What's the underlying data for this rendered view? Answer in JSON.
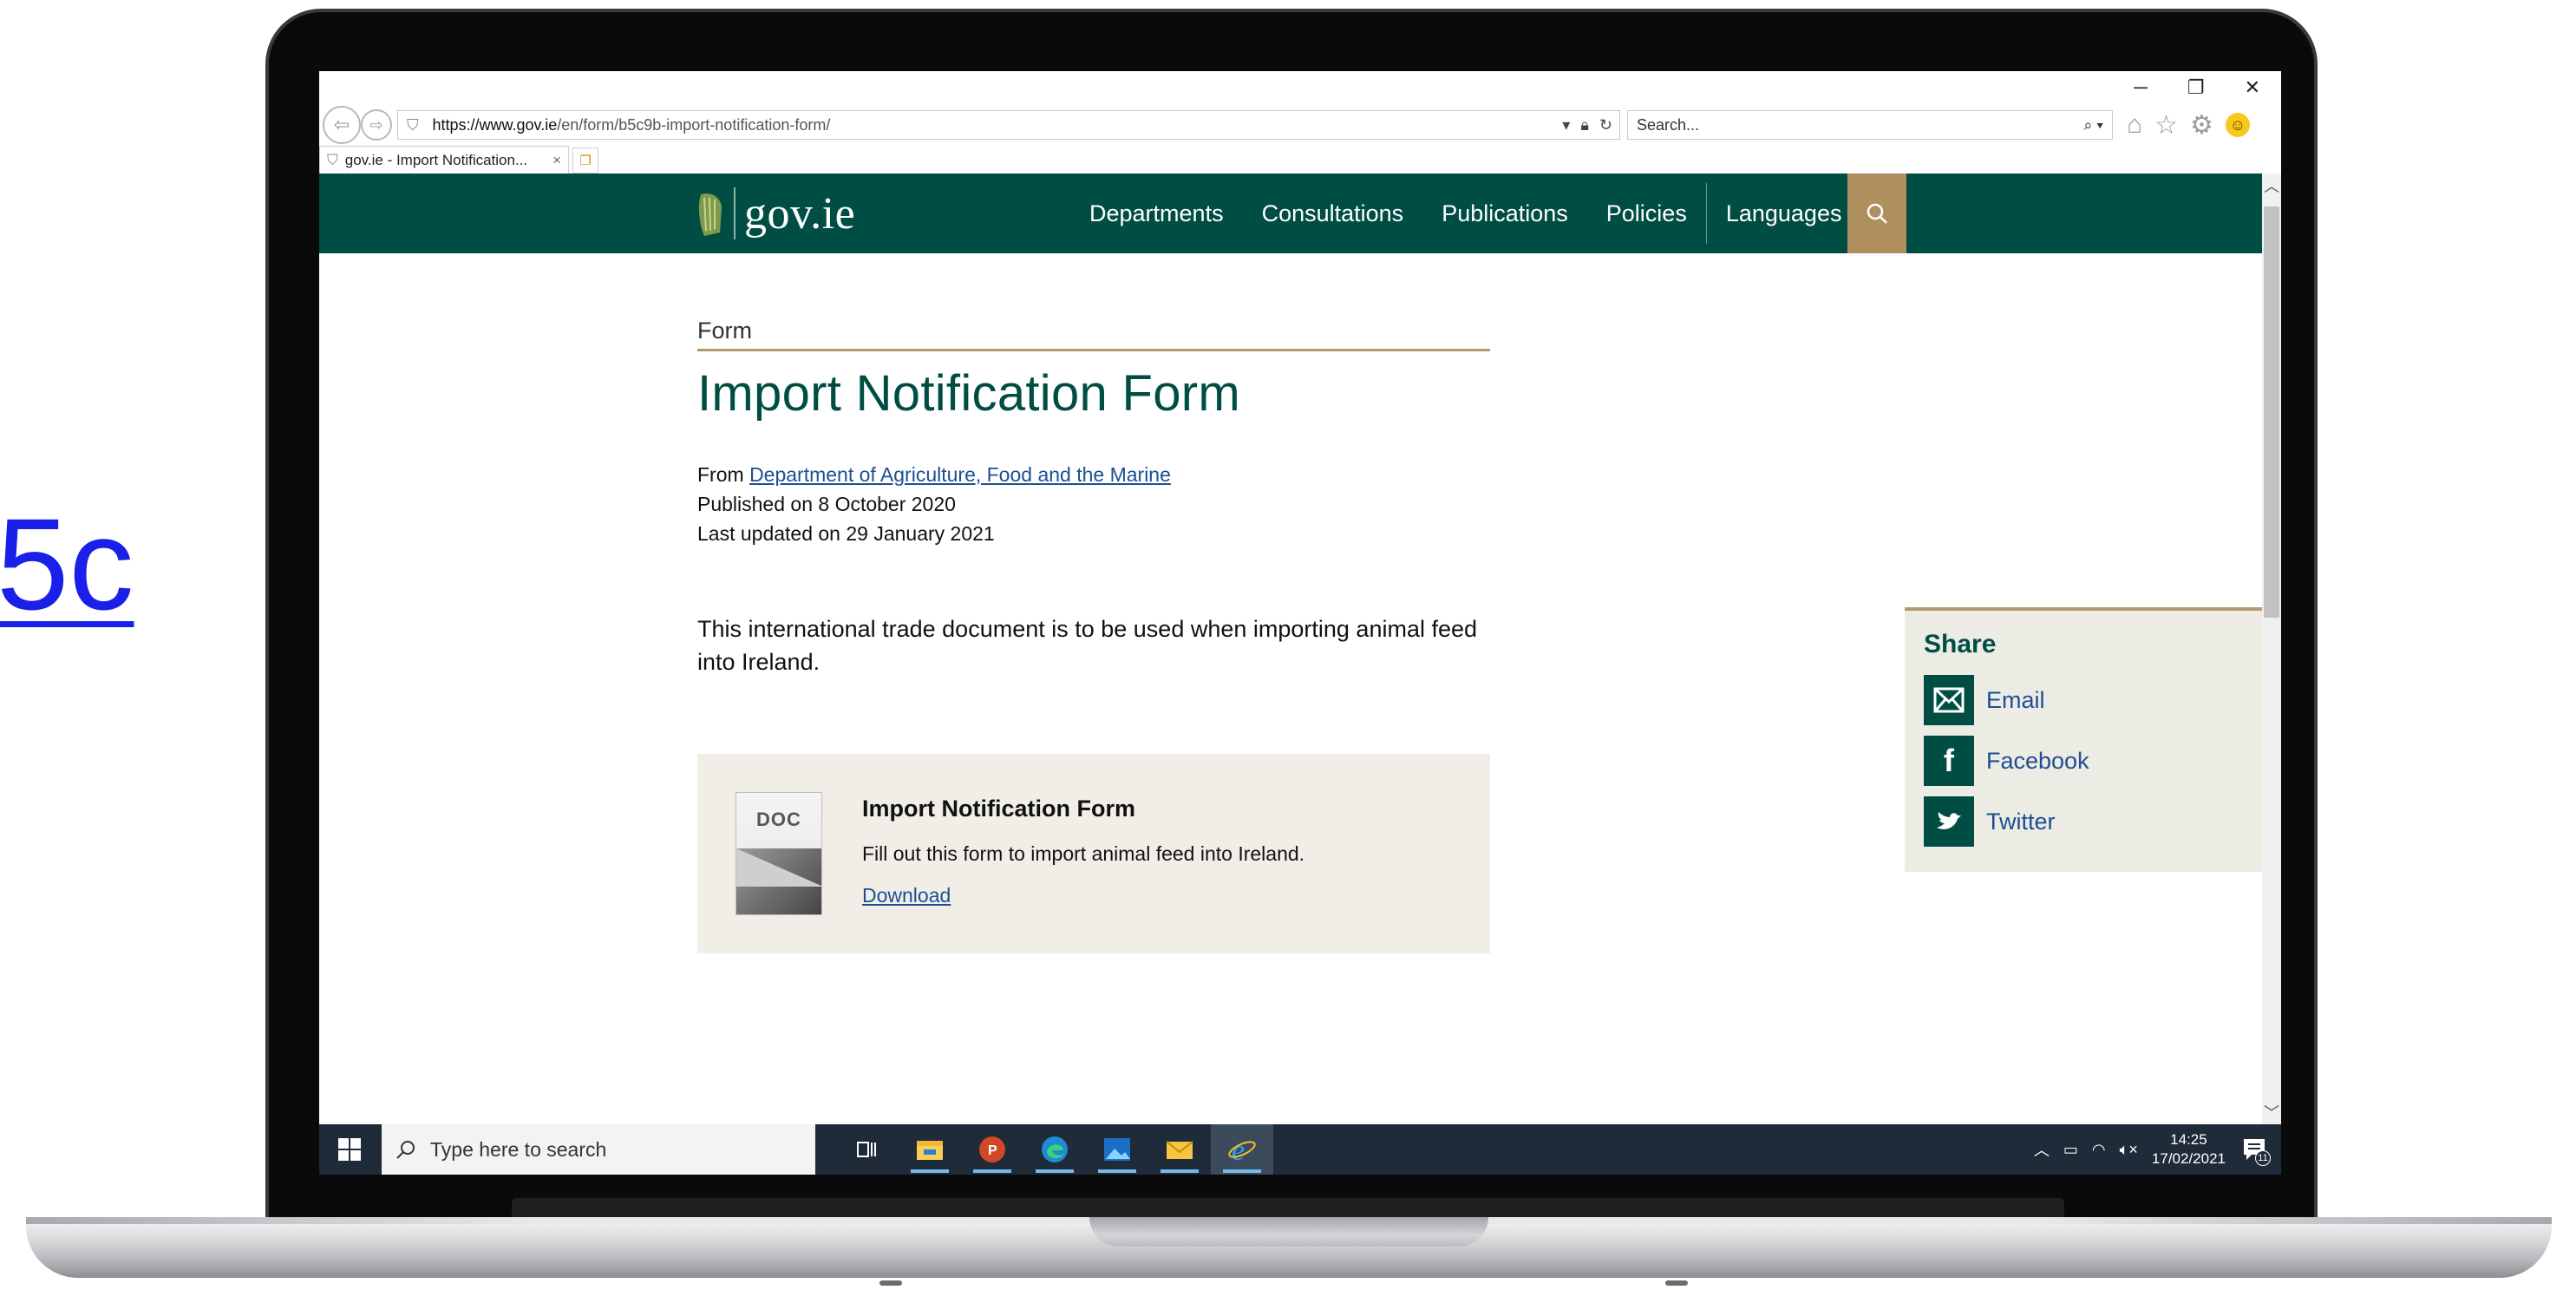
{
  "overlay": {
    "side_link_text": "5c"
  },
  "browser": {
    "address": {
      "host": "https://www.gov.ie",
      "path": "/en/form/b5c9b-import-notification-form/"
    },
    "search_placeholder": "Search...",
    "tab_title": "gov.ie - Import Notification...",
    "tab_close": "×"
  },
  "site": {
    "logo_text": "gov.ie",
    "nav": [
      "Departments",
      "Consultations",
      "Publications",
      "Policies",
      "Languages"
    ]
  },
  "article": {
    "eyebrow": "Form",
    "title": "Import Notification Form",
    "from_prefix": "From",
    "from_link": "Department of Agriculture, Food and the Marine",
    "published": "Published on 8 October 2020",
    "updated": "Last updated on 29 January 2021",
    "lead": "This international trade document is to be used when importing animal feed into Ireland."
  },
  "document": {
    "thumb_label": "DOC",
    "title": "Import Notification Form",
    "description": "Fill out this form to import animal feed into Ireland.",
    "link": "Download"
  },
  "share": {
    "title": "Share",
    "items": [
      "Email",
      "Facebook",
      "Twitter"
    ]
  },
  "taskbar": {
    "search_placeholder": "Type here to search",
    "time": "14:25",
    "date": "17/02/2021",
    "notification_count": "11"
  },
  "colors": {
    "brand_green": "#004d44",
    "gold_accent": "#b3996b",
    "link_blue": "#1d4f91",
    "side_link": "#1a20e8"
  },
  "icons": [
    "windows-start-icon",
    "search-icon",
    "task-view-icon",
    "file-explorer-icon",
    "powerpoint-icon",
    "edge-icon",
    "photos-icon",
    "mail-icon",
    "ie-icon",
    "email-icon",
    "facebook-icon",
    "twitter-icon",
    "harp-icon"
  ]
}
